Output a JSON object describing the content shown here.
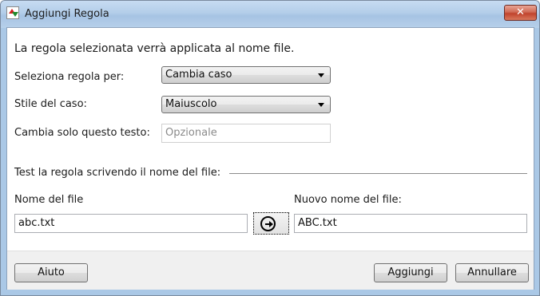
{
  "window": {
    "title": "Aggiungi Regola",
    "close_glyph": "✕"
  },
  "intro": "La regola selezionata verrà applicata al nome file.",
  "form": {
    "select_rule_label": "Seleziona regola per:",
    "select_rule_value": "Cambia caso",
    "case_style_label": "Stile del caso:",
    "case_style_value": "Maiuscolo",
    "only_text_label": "Cambia solo questo testo:",
    "only_text_placeholder": "Opzionale"
  },
  "test": {
    "heading": "Test la regola scrivendo il nome del file:",
    "filename_label": "Nome del file",
    "filename_value": "abc.txt",
    "new_filename_label": "Nuovo nome del file:",
    "new_filename_value": "ABC.txt"
  },
  "buttons": {
    "help": "Aiuto",
    "add": "Aggiungi",
    "cancel": "Annullare"
  },
  "icons": {
    "apply_test": "arrow-right-circle-icon",
    "app": "rename-arrows-icon"
  }
}
